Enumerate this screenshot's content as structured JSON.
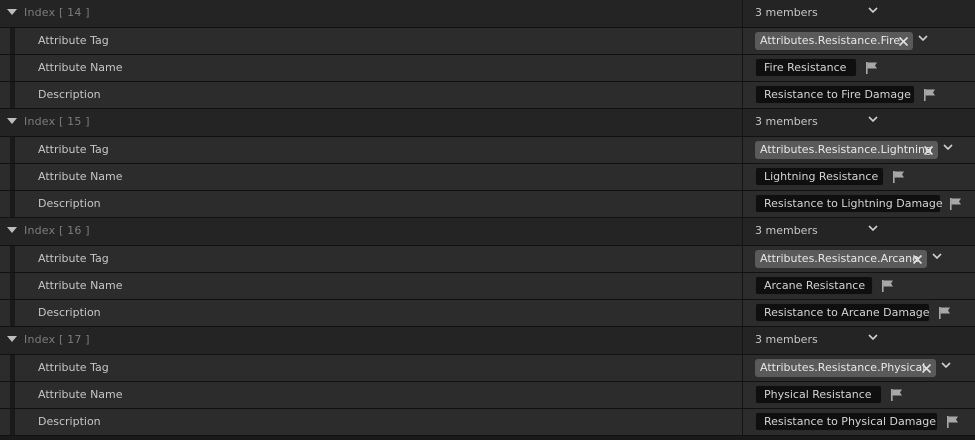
{
  "groups": [
    {
      "index_label": "Index [ 14 ]",
      "members": "3 members",
      "tag_label": "Attribute Tag",
      "tag_value": "Attributes.Resistance.Fire",
      "name_label": "Attribute Name",
      "name_value": "Fire Resistance",
      "desc_label": "Description",
      "desc_value": "Resistance to Fire Damage"
    },
    {
      "index_label": "Index [ 15 ]",
      "members": "3 members",
      "tag_label": "Attribute Tag",
      "tag_value": "Attributes.Resistance.Lightning",
      "name_label": "Attribute Name",
      "name_value": "Lightning Resistance",
      "desc_label": "Description",
      "desc_value": "Resistance to Lightning Damage"
    },
    {
      "index_label": "Index [ 16 ]",
      "members": "3 members",
      "tag_label": "Attribute Tag",
      "tag_value": "Attributes.Resistance.Arcane",
      "name_label": "Attribute Name",
      "name_value": "Arcane Resistance",
      "desc_label": "Description",
      "desc_value": "Resistance to Arcane Damage"
    },
    {
      "index_label": "Index [ 17 ]",
      "members": "3 members",
      "tag_label": "Attribute Tag",
      "tag_value": "Attributes.Resistance.Physical",
      "name_label": "Attribute Name",
      "name_value": "Physical Resistance",
      "desc_label": "Description",
      "desc_value": "Resistance to Physical Damage"
    }
  ],
  "icons": {
    "expander": "triangle-down-icon",
    "members_dropdown": "chevron-down-icon",
    "tag_clear": "close-icon",
    "tag_dropdown": "chevron-down-icon",
    "localize": "flag-icon"
  },
  "colors": {
    "background": "#1a1a1a",
    "header_row": "#242424",
    "property_row": "#2c2c2c",
    "tag_chip": "#5a5a5a",
    "text_box": "#0f0f0f"
  }
}
